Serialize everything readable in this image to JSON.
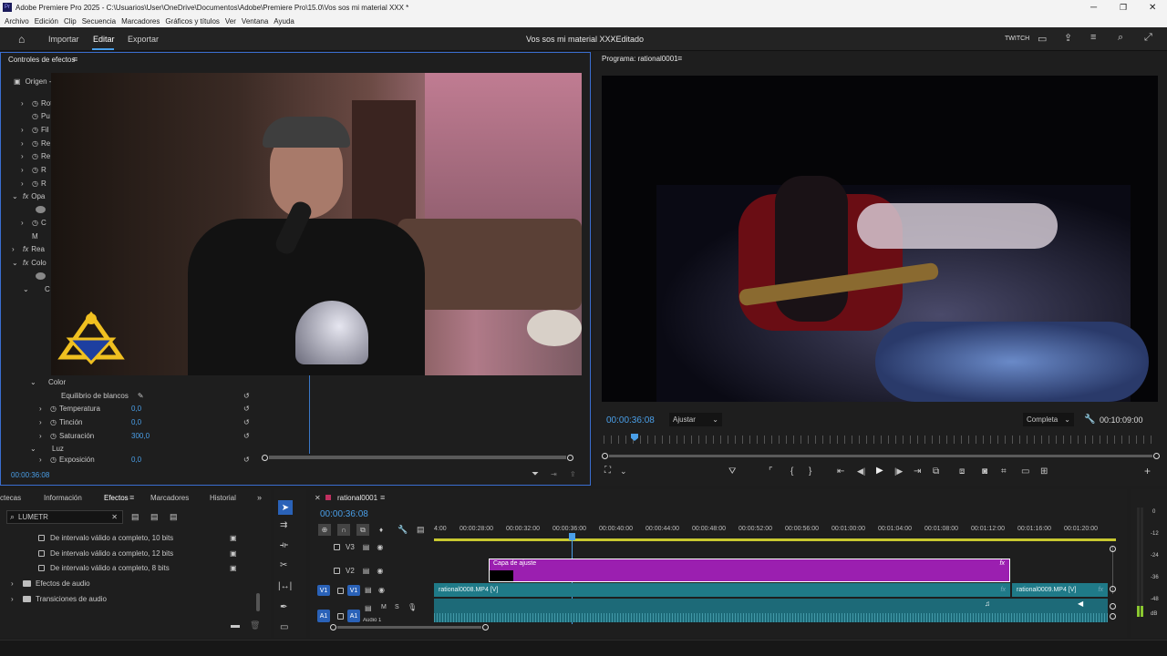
{
  "window": {
    "title": "Adobe Premiere Pro 2025 - C:\\Usuarios\\User\\OneDrive\\Documentos\\Adobe\\Premiere Pro\\15.0\\Vos sos mi material XXX *",
    "app_icon": "Pr"
  },
  "menu": [
    "Archivo",
    "Edición",
    "Clip",
    "Secuencia",
    "Marcadores",
    "Gráficos y títulos",
    "Ver",
    "Ventana",
    "Ayuda"
  ],
  "header": {
    "nav": [
      "Importar",
      "Editar",
      "Exportar"
    ],
    "active": "Editar",
    "title": "Vos sos mi material XXX",
    "status": "- Editado",
    "twitch": "TWITCH"
  },
  "effect_controls": {
    "title": "Controles de efectos",
    "source": "Origen - ",
    "left_rows": [
      {
        "label": "Rot",
        "exp": "›"
      },
      {
        "label": "Pu",
        "exp": ""
      },
      {
        "label": "Fil",
        "exp": "›"
      },
      {
        "label": "Re",
        "exp": "›"
      },
      {
        "label": "Re",
        "exp": "›"
      },
      {
        "label": "R",
        "exp": "›"
      },
      {
        "label": "R",
        "exp": "›"
      },
      {
        "label": "Opa",
        "exp": "⌄"
      },
      {
        "label": "",
        "exp": ""
      },
      {
        "label": "C",
        "exp": "›"
      },
      {
        "label": "M",
        "exp": ""
      },
      {
        "label": "Rea",
        "exp": "›"
      },
      {
        "label": "Colo",
        "exp": "⌄"
      },
      {
        "label": "",
        "exp": ""
      },
      {
        "label": "C",
        "exp": "⌄"
      }
    ],
    "section_color": "Color",
    "white_balance": "Equilibrio de blancos",
    "params": [
      {
        "label": "Temperatura",
        "value": "0,0"
      },
      {
        "label": "Tinción",
        "value": "0,0"
      },
      {
        "label": "Saturación",
        "value": "300,0"
      }
    ],
    "section_light": "Luz",
    "exposure_label": "Exposición",
    "exposure_value": "0,0",
    "timecode": "00:00:36:08"
  },
  "program": {
    "title": "Programa: rational0001",
    "timecode": "00:00:36:08",
    "fit": "Ajustar",
    "quality": "Completa",
    "duration": "00:10:09:00"
  },
  "effects_panel": {
    "tabs": [
      "ctecas",
      "Información",
      "Efectos",
      "Marcadores",
      "Historial"
    ],
    "active_tab": "Efectos",
    "search_value": "LUMETR",
    "items": [
      "De intervalo válido a completo, 10 bits",
      "De intervalo válido a completo, 12 bits",
      "De intervalo válido a completo, 8 bits"
    ],
    "folders": [
      "Efectos de audio",
      "Transiciones de audio"
    ]
  },
  "timeline": {
    "sequence": "rational0001",
    "timecode": "00:00:36:08",
    "ruler": [
      "4:00",
      "00:00:28:00",
      "00:00:32:00",
      "00:00:36:00",
      "00:00:40:00",
      "00:00:44:00",
      "00:00:48:00",
      "00:00:52:00",
      "00:00:56:00",
      "00:01:00:00",
      "00:01:04:00",
      "00:01:08:00",
      "00:01:12:00",
      "00:01:16:00",
      "00:01:20:00"
    ],
    "tracks": {
      "v3": "V3",
      "v2": "V2",
      "v1": "V1",
      "a1": "A1",
      "audio_label": "Audio 1"
    },
    "clips": {
      "adjustment": "Capa de ajuste",
      "v1_a": "rational0008.MP4 [V]",
      "v1_b": "rational0009.MP4 [V]",
      "fx": "fx"
    },
    "audio_meter": [
      "0",
      "-12",
      "-24",
      "-36",
      "-48",
      "dB"
    ]
  },
  "colors": {
    "accent": "#4a9fe8",
    "adjustment_clip": "#9b1fb0",
    "video_clip": "#1f7a88",
    "track_target": "#2a62b8"
  }
}
